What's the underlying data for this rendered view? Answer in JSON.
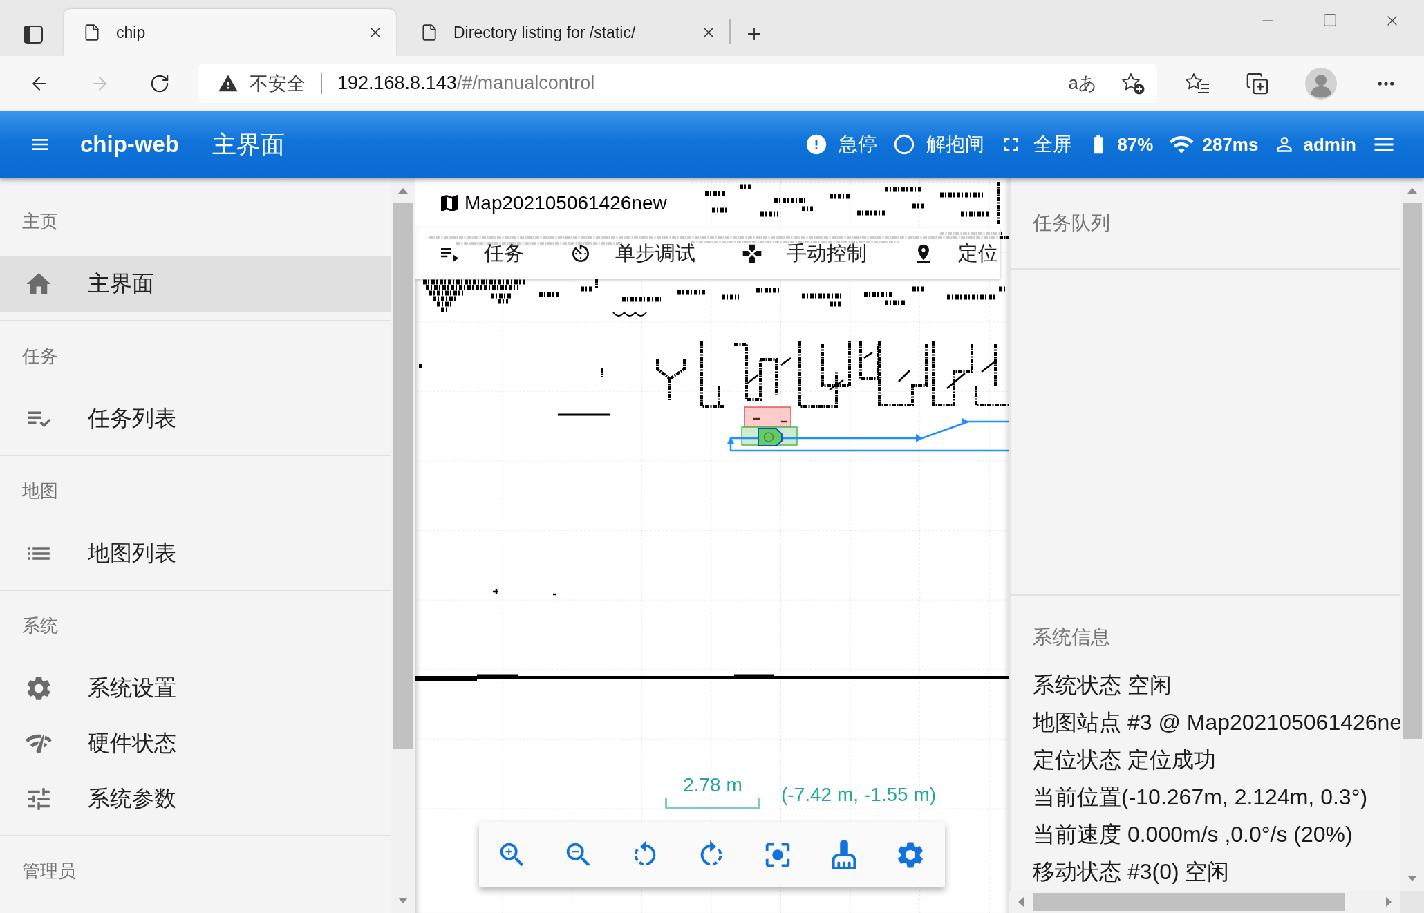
{
  "browser": {
    "tabs": [
      {
        "title": "chip",
        "selected": true
      },
      {
        "title": "Directory listing for /static/",
        "selected": false
      }
    ],
    "nav": [
      {
        "disabled": false
      },
      {
        "disabled": true
      },
      {
        "disabled": false
      }
    ],
    "address": {
      "security": "不安全",
      "host": "192.168.8.143",
      "path": "/#/manualcontrol",
      "read_aloud": "aあ"
    }
  },
  "app_bar": {
    "brand": "chip-web",
    "title": "主界面",
    "actions": [
      "急停",
      "解抱闸",
      "全屏"
    ],
    "status": [
      "87%",
      "287ms",
      "admin"
    ]
  },
  "sidebar": {
    "sections": [
      {
        "title": "主页",
        "items": [
          {
            "label": "主界面",
            "selected": true
          }
        ]
      },
      {
        "title": "任务",
        "items": [
          {
            "label": "任务列表",
            "selected": false
          }
        ]
      },
      {
        "title": "地图",
        "items": [
          {
            "label": "地图列表",
            "selected": false
          }
        ]
      },
      {
        "title": "系统",
        "items": [
          {
            "label": "系统设置",
            "selected": false
          },
          {
            "label": "硬件状态",
            "selected": false
          },
          {
            "label": "系统参数",
            "selected": false
          }
        ]
      },
      {
        "title": "管理员"
      }
    ]
  },
  "map": {
    "name": "Map202105061426new",
    "modes": [
      "任务",
      "单步调试",
      "手动控制",
      "定位"
    ],
    "scale": "2.78 m",
    "cursor": "(-7.42 m, -1.55 m)"
  },
  "panels": {
    "task_queue": {
      "title": "任务队列"
    },
    "system_info": {
      "title": "系统信息",
      "lines": [
        "系统状态 空闲",
        "地图站点 #3 @ Map202105061426ne",
        "定位状态 定位成功",
        "当前位置(-10.267m, 2.124m, 0.3°)",
        "当前速度 0.000m/s ,0.0°/s (20%)",
        "移动状态 #3(0) 空闲"
      ]
    }
  }
}
